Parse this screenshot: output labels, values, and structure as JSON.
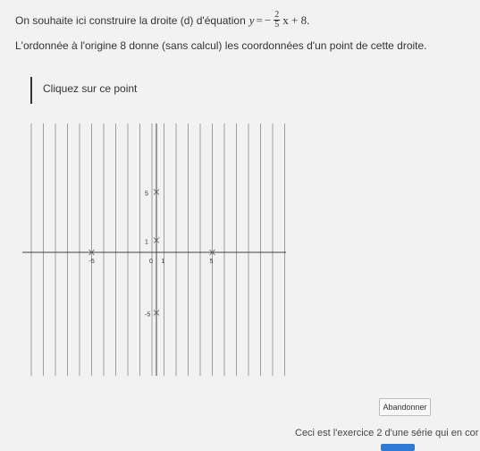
{
  "instruction": {
    "intro": "On souhaite ici construire la droite (d) d'équation",
    "equation": {
      "lhs": "y",
      "equals": "=",
      "sign": "−",
      "numerator": "2",
      "denominator": "5",
      "rest": "x + 8."
    },
    "line2": "L'ordonnée à l'origine 8 donne (sans calcul) les coordonnées d'un point de cette droite.",
    "prompt": "Cliquez sur ce point"
  },
  "graph": {
    "x_range": [
      -11,
      11
    ],
    "y_range": [
      -11,
      11
    ],
    "labels": [
      {
        "text": "5",
        "x": 0,
        "y": 5,
        "marker": true
      },
      {
        "text": "1",
        "x": 0,
        "y": 1,
        "marker": true
      },
      {
        "text": "-5",
        "x": -5,
        "y": 0,
        "marker": true
      },
      {
        "text": "0",
        "x": 0,
        "y": 0,
        "marker": false
      },
      {
        "text": "1",
        "x": 1,
        "y": 0,
        "marker": false
      },
      {
        "text": "5",
        "x": 5,
        "y": 0,
        "marker": true
      },
      {
        "text": "-5",
        "x": 0,
        "y": -5,
        "marker": true
      }
    ]
  },
  "buttons": {
    "abandon": "Abandonner"
  },
  "footer": {
    "text": "Ceci est l'exercice 2 d'une série qui en cor"
  },
  "colors": {
    "grid": "#888888",
    "axis": "#444444",
    "progress": "#2e7bd6"
  }
}
